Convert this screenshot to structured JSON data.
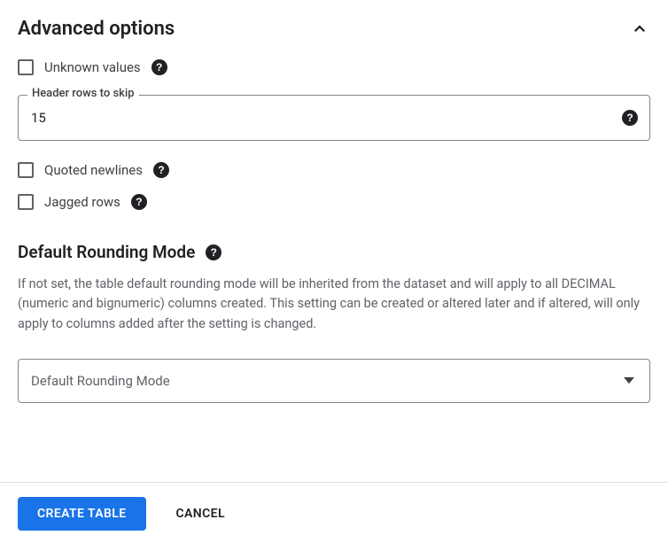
{
  "section": {
    "title": "Advanced options"
  },
  "unknown_values": {
    "label": "Unknown values"
  },
  "header_rows": {
    "label": "Header rows to skip",
    "value": "15"
  },
  "quoted_newlines": {
    "label": "Quoted newlines"
  },
  "jagged_rows": {
    "label": "Jagged rows"
  },
  "rounding": {
    "heading": "Default Rounding Mode",
    "description": "If not set, the table default rounding mode will be inherited from the dataset and will apply to all DECIMAL (numeric and bignumeric) columns created. This setting can be created or altered later and if altered, will only apply to columns added after the setting is changed.",
    "selected": "Default Rounding Mode"
  },
  "buttons": {
    "create": "CREATE TABLE",
    "cancel": "CANCEL"
  }
}
